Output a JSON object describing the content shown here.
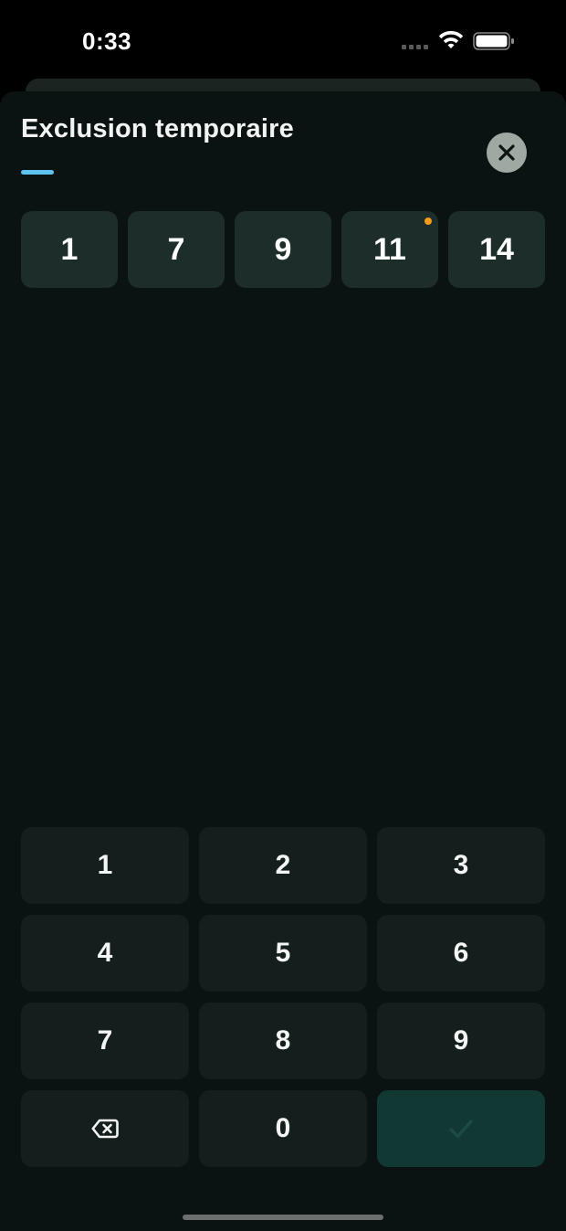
{
  "status_bar": {
    "time": "0:33",
    "icons": [
      "cellular-signal-icon",
      "wifi-icon",
      "battery-icon"
    ]
  },
  "sheet": {
    "title": "Exclusion temporaire",
    "accent_color": "#5fc3ef",
    "close_icon": "close-icon"
  },
  "chips": [
    {
      "label": "1",
      "has_indicator": false
    },
    {
      "label": "7",
      "has_indicator": false
    },
    {
      "label": "9",
      "has_indicator": false
    },
    {
      "label": "11",
      "has_indicator": true
    },
    {
      "label": "14",
      "has_indicator": false
    }
  ],
  "indicator_color": "#f59a1b",
  "keypad": {
    "keys": [
      "1",
      "2",
      "3",
      "4",
      "5",
      "6",
      "7",
      "8",
      "9"
    ],
    "zero": "0",
    "backspace_icon": "backspace-icon",
    "confirm_icon": "checkmark-icon"
  }
}
